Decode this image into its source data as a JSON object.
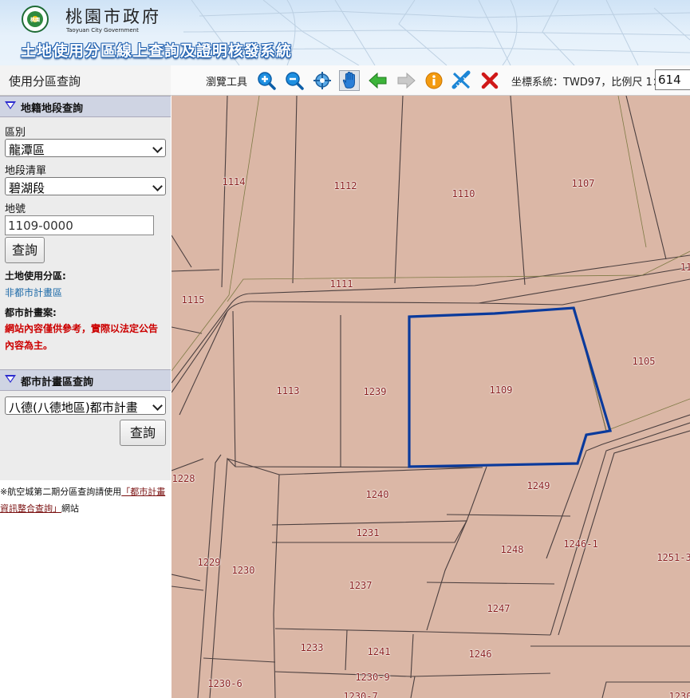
{
  "header": {
    "org_name": "桃園市政府",
    "org_name_en": "Taoyuan City Government",
    "emblem_text": "桃園",
    "system_title": "土地使用分區線上查詢及證明核發系統"
  },
  "sidebar": {
    "tab_label": "使用分區查詢",
    "cadastral_panel": {
      "title": "地籍地段查詢",
      "district_label": "區別",
      "district_value": "龍潭區",
      "section_label": "地段清單",
      "section_value": "碧湖段",
      "lot_label": "地號",
      "lot_value": "1109-0000",
      "query_button": "查詢",
      "zone_label": "土地使用分區:",
      "zone_value": "非都市計畫區",
      "plan_label": "都市計畫案:",
      "warning": "網站內容僅供參考，實際以法定公告內容為主。"
    },
    "urban_plan_panel": {
      "title": "都市計畫區查詢",
      "plan_value": "八德(八德地區)都市計畫",
      "query_button": "查詢"
    },
    "note_text": "※航空城第二期分區查詢請使用",
    "note_link": "「都市計畫資訊整合查詢」",
    "note_suffix": "網站"
  },
  "toolbar": {
    "label": "瀏覽工具",
    "icons": [
      "zoom-in-icon",
      "zoom-out-icon",
      "full-extent-icon",
      "pan-hand-icon",
      "previous-extent-icon",
      "next-extent-icon",
      "info-icon",
      "measure-icon",
      "clear-icon"
    ],
    "coord_text": "坐標系統：TWD97，比例尺 1：",
    "scale_value": "614"
  },
  "map": {
    "highlight_color": "#0a3a9c",
    "parcel_fill": "#dbb7a6",
    "labels": [
      "1114",
      "1112",
      "1110",
      "1107",
      "1111",
      "11",
      "1115",
      "1105",
      "1113",
      "1239",
      "1109",
      "1228",
      "1240",
      "1249",
      "1231",
      "1248",
      "1246-1",
      "1251-3",
      "1229",
      "1230",
      "1237",
      "1247",
      "1233",
      "1241",
      "1246",
      "1230-6",
      "1230-9",
      "1230-7",
      "1230"
    ]
  }
}
